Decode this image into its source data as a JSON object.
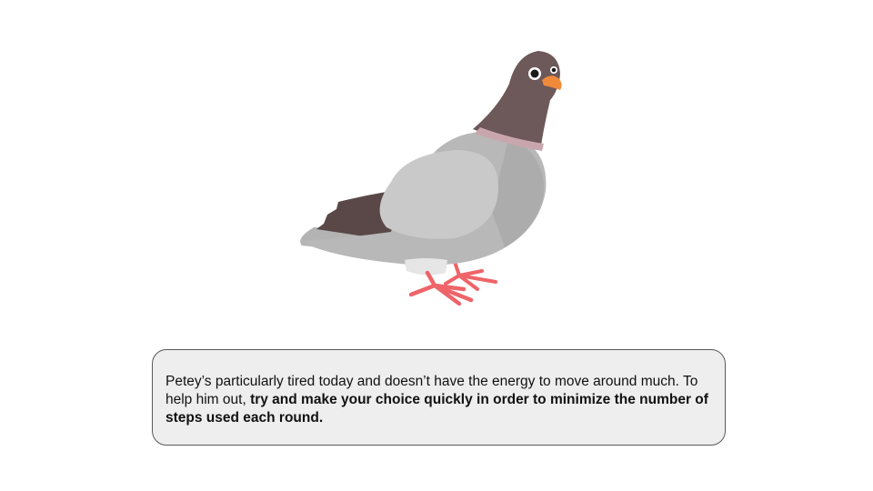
{
  "slide": {
    "illustration": {
      "icon": "pigeon-illustration",
      "colors": {
        "head": "#6d585a",
        "body_light": "#b8b8b8",
        "wing": "#c9c9c9",
        "tail_dark": "#5a4748",
        "beak": "#f08a3a",
        "feet": "#ee6468"
      }
    },
    "message": {
      "regular": "Petey’s particularly tired today and doesn’t have the energy to move around much. To help him out, ",
      "bold": "try and make your choice quickly in order to minimize the number of steps used each round."
    }
  }
}
